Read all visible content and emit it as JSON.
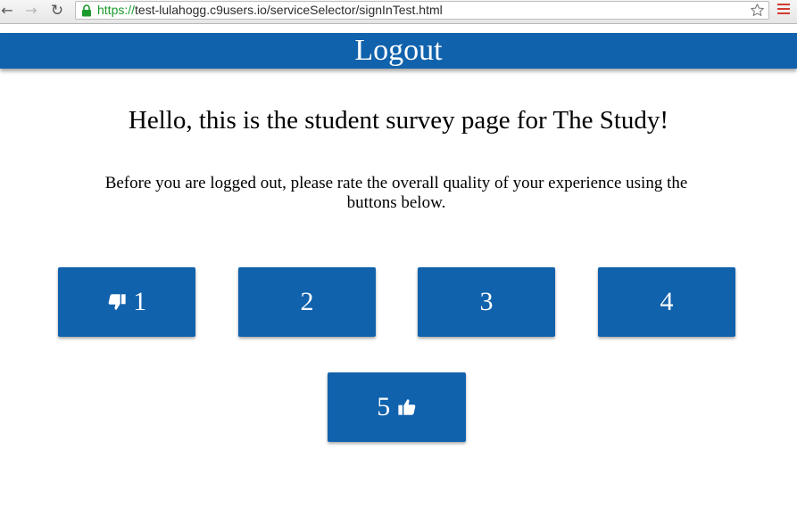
{
  "browser": {
    "url_scheme": "https://",
    "url_rest": "test-lulahogg.c9users.io/serviceSelector/signInTest.html"
  },
  "header": {
    "logout_label": "Logout",
    "color": "#1162ac"
  },
  "main": {
    "title": "Hello, this is the student survey page for The Study!",
    "instructions": "Before you are logged out, please rate the overall quality of your experience using the buttons below."
  },
  "rating_buttons": [
    {
      "label": "1",
      "icon": "thumbs-down-icon"
    },
    {
      "label": "2"
    },
    {
      "label": "3"
    },
    {
      "label": "4"
    },
    {
      "label": "5",
      "icon": "thumbs-up-icon"
    }
  ]
}
